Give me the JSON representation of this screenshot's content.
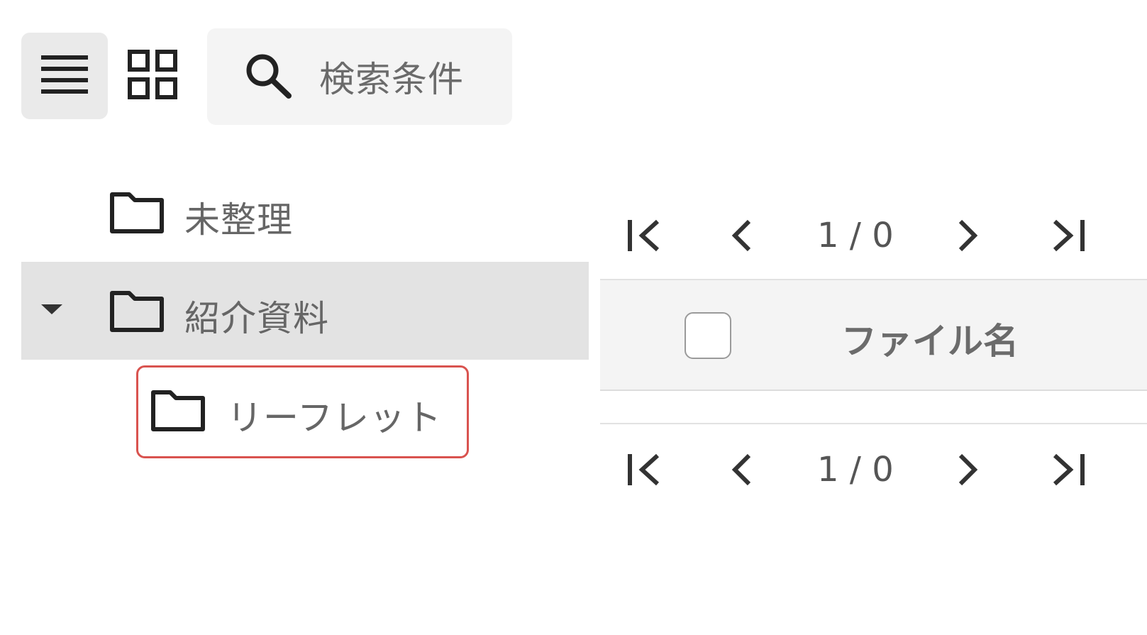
{
  "toolbar": {
    "list_view_icon": "list-view-icon",
    "grid_view_icon": "grid-view-icon",
    "search": {
      "icon": "search-icon",
      "label": "検索条件"
    }
  },
  "tree": {
    "items": [
      {
        "label": "未整理",
        "icon": "folder-icon",
        "expanded": null,
        "selected": false
      },
      {
        "label": "紹介資料",
        "icon": "folder-icon",
        "expanded": true,
        "selected": true
      },
      {
        "label": "リーフレット",
        "icon": "folder-icon",
        "expanded": null,
        "selected": false,
        "highlighted": true
      }
    ]
  },
  "pager_top": {
    "page_text": "1 / 0"
  },
  "pager_bottom": {
    "page_text": "1 / 0"
  },
  "table": {
    "columns": [
      {
        "label": "ファイル名"
      }
    ],
    "rows": []
  },
  "colors": {
    "selected_row": "#e3e3e3",
    "highlight_border": "#d9534f",
    "header_bg": "#f4f4f4"
  }
}
